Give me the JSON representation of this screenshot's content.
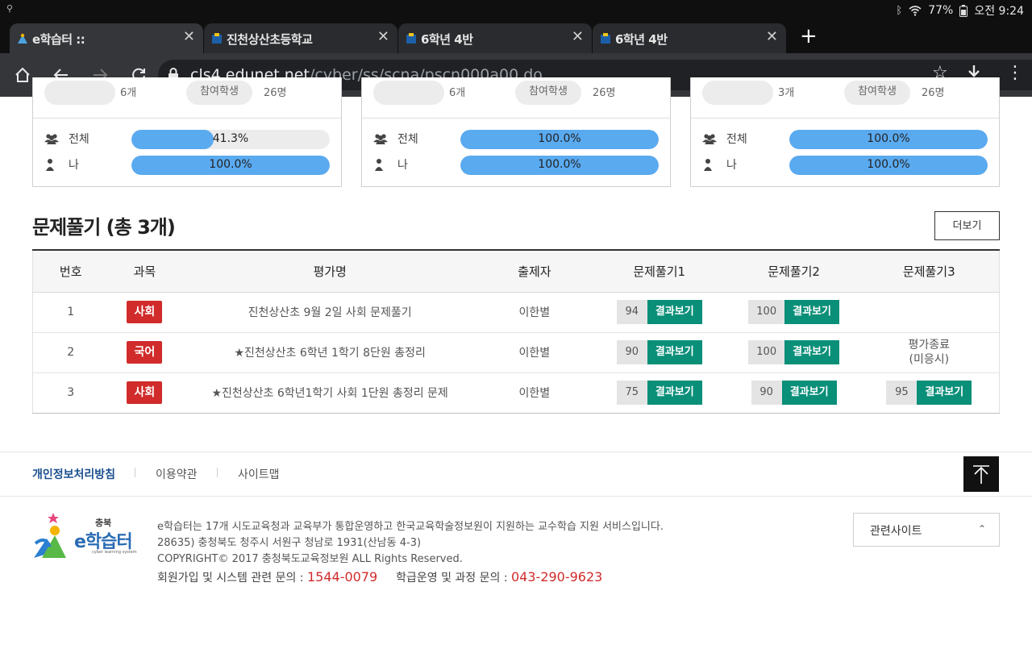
{
  "status_bar": {
    "battery": "77%",
    "time": "오전 9:24"
  },
  "tabs": [
    {
      "title": "e학습터 ::",
      "active": true
    },
    {
      "title": "진천상산초등학교",
      "active": false
    },
    {
      "title": "6학년 4반",
      "active": false
    },
    {
      "title": "6학년 4반",
      "active": false
    }
  ],
  "new_tab_label": "+",
  "url": {
    "host": "cls4.edunet.net",
    "path": "/cyber/ss/scna/pscn000a00.do"
  },
  "stat_cards": [
    {
      "pill1": "",
      "val1": "6개",
      "pill2": "참여학생",
      "val2": "26명",
      "all_label": "전체",
      "all_pct": "41.3%",
      "all_value": 41.3,
      "me_label": "나",
      "me_pct": "100.0%",
      "me_value": 100
    },
    {
      "pill1": "",
      "val1": "6개",
      "pill2": "참여학생",
      "val2": "26명",
      "all_label": "전체",
      "all_pct": "100.0%",
      "all_value": 100,
      "me_label": "나",
      "me_pct": "100.0%",
      "me_value": 100
    },
    {
      "pill1": "",
      "val1": "3개",
      "pill2": "참여학생",
      "val2": "26명",
      "all_label": "전체",
      "all_pct": "100.0%",
      "all_value": 100,
      "me_label": "나",
      "me_pct": "100.0%",
      "me_value": 100
    }
  ],
  "section": {
    "title": "문제풀기 (총 3개)",
    "more_label": "더보기"
  },
  "table": {
    "headers": [
      "번호",
      "과목",
      "평가명",
      "출제자",
      "문제풀기1",
      "문제풀기2",
      "문제풀기3"
    ],
    "result_label": "결과보기",
    "rows": [
      {
        "no": "1",
        "subject": "사회",
        "name": "진천상산초 9월 2일 사회 문제풀기",
        "author": "이한별",
        "s1": "94",
        "s2": "100",
        "s3": "",
        "s3_text": ""
      },
      {
        "no": "2",
        "subject": "국어",
        "name": "★진천상산초 6학년 1학기 8단원 총정리",
        "author": "이한별",
        "s1": "90",
        "s2": "100",
        "s3": "",
        "s3_text": "평가종료\n(미응시)"
      },
      {
        "no": "3",
        "subject": "사회",
        "name": "★진천상산초 6학년1학기 사회 1단원 총정리 문제",
        "author": "이한별",
        "s1": "75",
        "s2": "90",
        "s3": "95",
        "s3_text": ""
      }
    ]
  },
  "footer": {
    "links": [
      "개인정보처리방침",
      "이용약관",
      "사이트맵"
    ],
    "logo_top": "충북",
    "logo_main": "e학습터",
    "logo_sub": "cyber learning system",
    "info1": "e학습터는 17개 시도교육청과 교육부가 통합운영하고 한국교육학술정보원이 지원하는 교수학습 지원 서비스입니다.",
    "info2": "28635) 충청북도 청주시 서원구 청남로 1931(산남동 4-3)",
    "info3": "COPYRIGHT© 2017 충청북도교육정보원 ALL Rights Reserved.",
    "contact1_label": "회원가입 및 시스템 관련 문의 : ",
    "contact1_num": "1544-0079",
    "contact2_label": "학급운영 및 과정 문의 : ",
    "contact2_num": "043-290-9623",
    "related_label": "관련사이트"
  },
  "colors": {
    "progress_fill": "#5aaaf0",
    "subject_badge": "#d12b2b",
    "result_button": "#0a8f79",
    "link_primary": "#1a4f8f"
  }
}
